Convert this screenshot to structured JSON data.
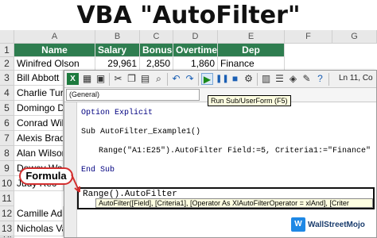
{
  "page_title": "VBA \"AutoFilter\"",
  "sheet": {
    "columns": [
      "A",
      "B",
      "C",
      "D",
      "E",
      "F",
      "G"
    ],
    "row_numbers": [
      "1",
      "2",
      "3",
      "4",
      "5",
      "6",
      "7",
      "8",
      "9",
      "10",
      "11",
      "12",
      "13",
      "14"
    ],
    "header_row": [
      "Name",
      "Salary",
      "Bonus",
      "Overtime",
      "Dep"
    ],
    "row2": [
      "Winifred Olson",
      "29,961",
      "2,850",
      "1,860",
      "Finance"
    ],
    "names": [
      "Bill Abbott",
      "Charlie Turi",
      "Domingo D",
      "Conrad Wil",
      "Alexis Bradl",
      "Alan Wilson",
      "Dewey Wac",
      "Judy Rec",
      "Camille Ada",
      "Nicholas Va"
    ]
  },
  "vbe": {
    "dropdown_value": "(General)",
    "status_text": "Ln 11, Co",
    "tooltip": "Run Sub/UserForm (F5)",
    "code": {
      "line1": "Option Explicit",
      "line2": "Sub AutoFilter_Example1()",
      "line3": "Range(\"A1:E25\").AutoFilter Field:=5, Criteria1:=\"Finance\"",
      "line4": "End Sub",
      "highlight": "Range().AutoFilter",
      "intellisense": "AutoFilter([Field], [Criteria1], [Operator As XlAutoFilterOperator = xlAnd], [Criter"
    }
  },
  "annotation": {
    "formula_label": "Formula"
  },
  "brand": {
    "name": "WallStreetMojo",
    "accent": "#1e88e5",
    "header_green": "#2e7d4f"
  },
  "icons": [
    "excel-icon",
    "save-icon",
    "cut-icon",
    "copy-icon",
    "paste-icon",
    "find-icon",
    "undo-icon",
    "redo-icon",
    "run-icon",
    "break-icon",
    "reset-icon",
    "design-mode-icon",
    "project-explorer-icon",
    "properties-icon",
    "object-browser-icon",
    "toolbox-icon",
    "help-icon"
  ]
}
